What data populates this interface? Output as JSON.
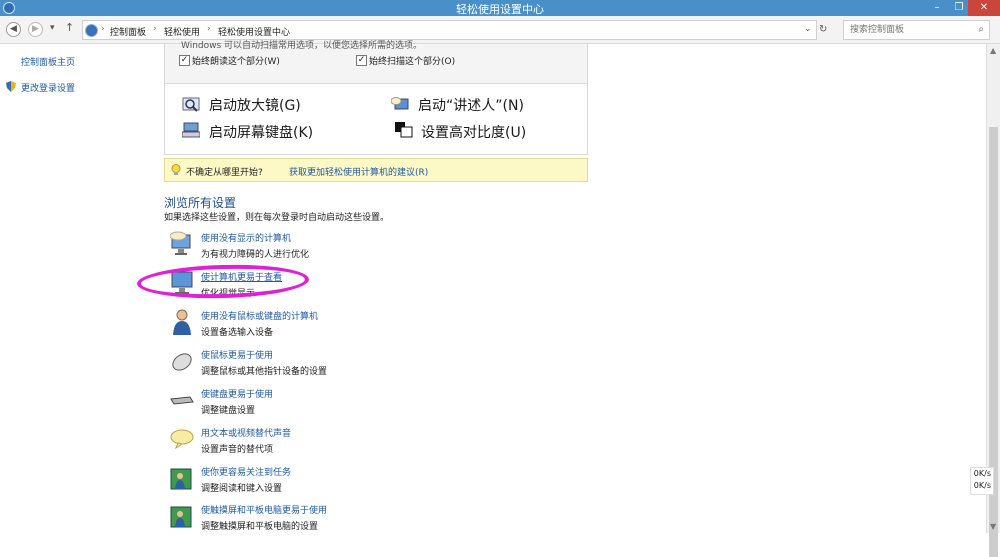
{
  "window": {
    "title": "轻松使用设置中心",
    "min": "–",
    "max": "❐",
    "close": "✕"
  },
  "nav": {
    "back": "◀",
    "forward": "▶",
    "history": "▾",
    "up": "↑",
    "refresh": "↻"
  },
  "breadcrumb": {
    "items": [
      "控制面板",
      "轻松使用",
      "轻松使用设置中心"
    ],
    "sep": "›",
    "dropdown": "⌄"
  },
  "search": {
    "placeholder": "搜索控制面板",
    "icon": "⌕"
  },
  "sidebar": {
    "items": [
      "控制面板主页",
      "更改登录设置"
    ]
  },
  "panel": {
    "cut_text": "Windows 可以自动扫描常用选项，以便您选择所需的选项。",
    "checkboxes": [
      {
        "label": "始终朗读这个部分(W)",
        "mark": "✓"
      },
      {
        "label": "始终扫描这个部分(O)",
        "mark": "✓"
      }
    ],
    "actions": [
      "启动放大镜(G)",
      "启动“讲述人”(N)",
      "启动屏幕键盘(K)",
      "设置高对比度(U)"
    ]
  },
  "tip": {
    "prefix": "不确定从哪里开始?",
    "link": "获取更加轻松使用计算机的建议(R)"
  },
  "browse": {
    "heading": "浏览所有设置",
    "subheading": "如果选择这些设置，则在每次登录时自动启动这些设置。",
    "items": [
      {
        "link": "使用没有显示的计算机",
        "desc": "为有视力障碍的人进行优化"
      },
      {
        "link": "使计算机更易于查看",
        "desc": "优化视觉显示"
      },
      {
        "link": "使用没有鼠标或键盘的计算机",
        "desc": "设置备选输入设备"
      },
      {
        "link": "使鼠标更易于使用",
        "desc": "调整鼠标或其他指针设备的设置"
      },
      {
        "link": "使键盘更易于使用",
        "desc": "调整键盘设置"
      },
      {
        "link": "用文本或视频替代声音",
        "desc": "设置声音的替代项"
      },
      {
        "link": "使你更容易关注到任务",
        "desc": "调整阅读和键入设置"
      },
      {
        "link": "使触摸屏和平板电脑更易于使用",
        "desc": "调整触摸屏和平板电脑的设置"
      }
    ]
  },
  "scrollbar": {
    "up": "▲",
    "down": "▼"
  },
  "netspeed": {
    "line1": "0K/s",
    "line2": "0K/s"
  },
  "colors": {
    "titlebar": "#4a90c8",
    "link": "#1e5aa8",
    "highlight": "#e020d8",
    "tip_bg": "#fcf9c6"
  }
}
